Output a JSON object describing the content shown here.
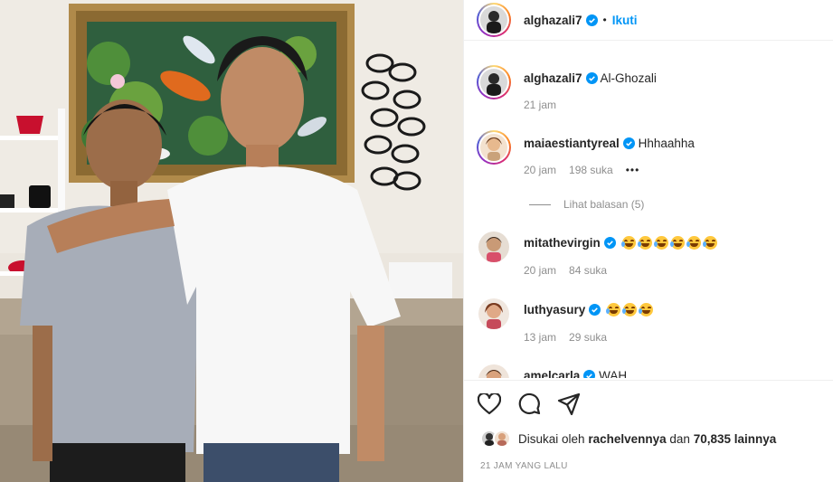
{
  "post": {
    "author": "alghazali7",
    "follow_label": "Ikuti",
    "separator": "•"
  },
  "caption": {
    "author": "alghazali7",
    "text": "Al-Ghozali",
    "time": "21 jam"
  },
  "comments": [
    {
      "user": "maiaestiantyreal",
      "verified": true,
      "text": "Hhhaahha",
      "time": "20 jam",
      "likes": "198 suka",
      "more": "•••"
    },
    {
      "user": "mitathevirgin",
      "verified": true,
      "text": "",
      "emoji_count": 6,
      "time": "20 jam",
      "likes": "84 suka"
    },
    {
      "user": "luthyasury",
      "verified": true,
      "text": "",
      "emoji_count": 3,
      "time": "13 jam",
      "likes": "29 suka"
    },
    {
      "user": "amelcarla",
      "verified": true,
      "text": "WAH"
    }
  ],
  "view_replies": "Lihat balasan (5)",
  "likes": {
    "prefix": "Disukai oleh",
    "user": "rachelvennya",
    "middle": "dan",
    "count": "70,835 lainnya"
  },
  "posted_ago": "21 JAM YANG LALU",
  "icons": {
    "like": "heart-icon",
    "comment": "comment-icon",
    "share": "share-icon",
    "verified": "verified-badge-icon"
  },
  "colors": {
    "accent": "#0095f6",
    "muted": "#8e8e8e",
    "verified": "#0095f6"
  }
}
